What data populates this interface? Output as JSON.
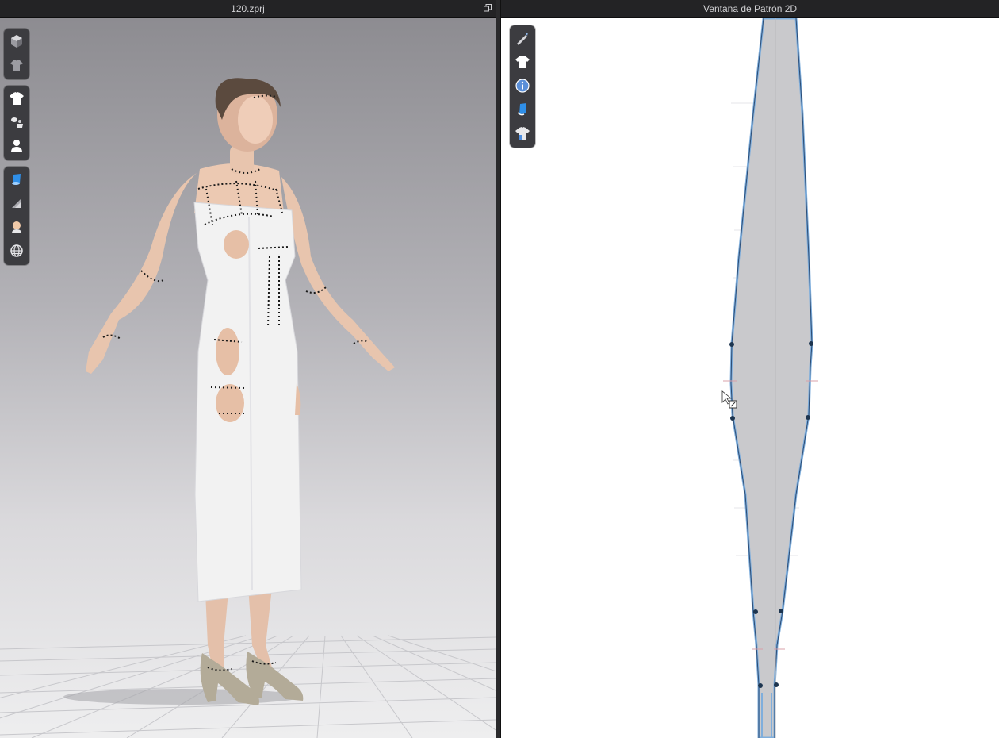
{
  "window_3d": {
    "title": "120.zprj",
    "restore_icon": "restore-window-icon"
  },
  "window_2d": {
    "title": "Ventana de Patrón 2D"
  },
  "toolbar_3d": {
    "groups": [
      [
        "cube-view-icon",
        "garment-display-icon"
      ],
      [
        "shirt-icon",
        "avatar-accessories-icon",
        "avatar-icon"
      ],
      [
        "fabric-texture-icon",
        "surface-icon",
        "skin-icon",
        "globe-icon"
      ]
    ]
  },
  "toolbar_2d": {
    "items": [
      "pen-tool-icon",
      "shirt-icon",
      "info-icon",
      "fabric-paint-icon",
      "pattern-shirt-icon"
    ]
  },
  "colors": {
    "pattern_fill": "#c9c9cc",
    "pattern_outline": "#7faedc",
    "dress": "#f2f2f2",
    "skin": "#e6bfa6"
  }
}
